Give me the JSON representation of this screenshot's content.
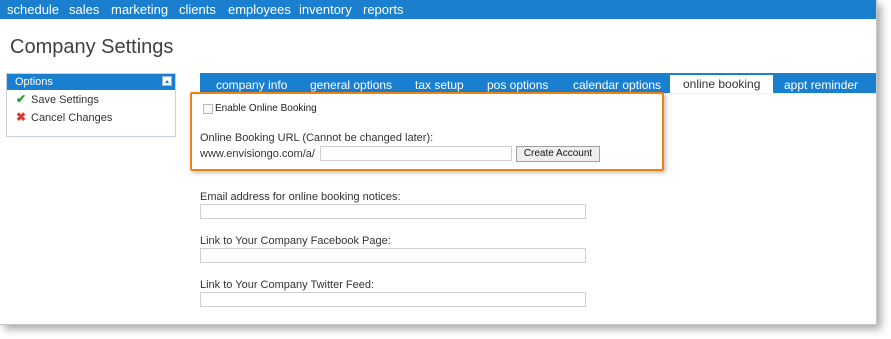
{
  "topnav": {
    "items": [
      "schedule",
      "sales",
      "marketing",
      "clients",
      "employees",
      "inventory",
      "reports"
    ]
  },
  "page": {
    "title": "Company Settings"
  },
  "options": {
    "header": "Options",
    "save_label": "Save Settings",
    "cancel_label": "Cancel Changes"
  },
  "tabs": {
    "items": [
      "company info",
      "general options",
      "tax setup",
      "pos options",
      "calendar options",
      "online booking",
      "appt reminder"
    ],
    "active": "online booking"
  },
  "online_booking": {
    "enable_label": "Enable Online Booking",
    "url_label": "Online Booking URL (Cannot be changed later):",
    "url_prefix": "www.envisiongo.com/a/",
    "url_value": "",
    "create_button": "Create Account",
    "email_label": "Email address for online booking notices:",
    "email_value": "",
    "facebook_label": "Link to Your Company Facebook Page:",
    "facebook_value": "",
    "twitter_label": "Link to Your Company Twitter Feed:",
    "twitter_value": ""
  },
  "colors": {
    "brand_blue": "#1b7fd0",
    "highlight_orange": "#f0820f",
    "check_green": "#2e9b2e",
    "cancel_red": "#e23b2e"
  },
  "icons": {
    "save": "check-icon",
    "cancel": "x-icon",
    "collapse": "collapse-up-icon"
  }
}
